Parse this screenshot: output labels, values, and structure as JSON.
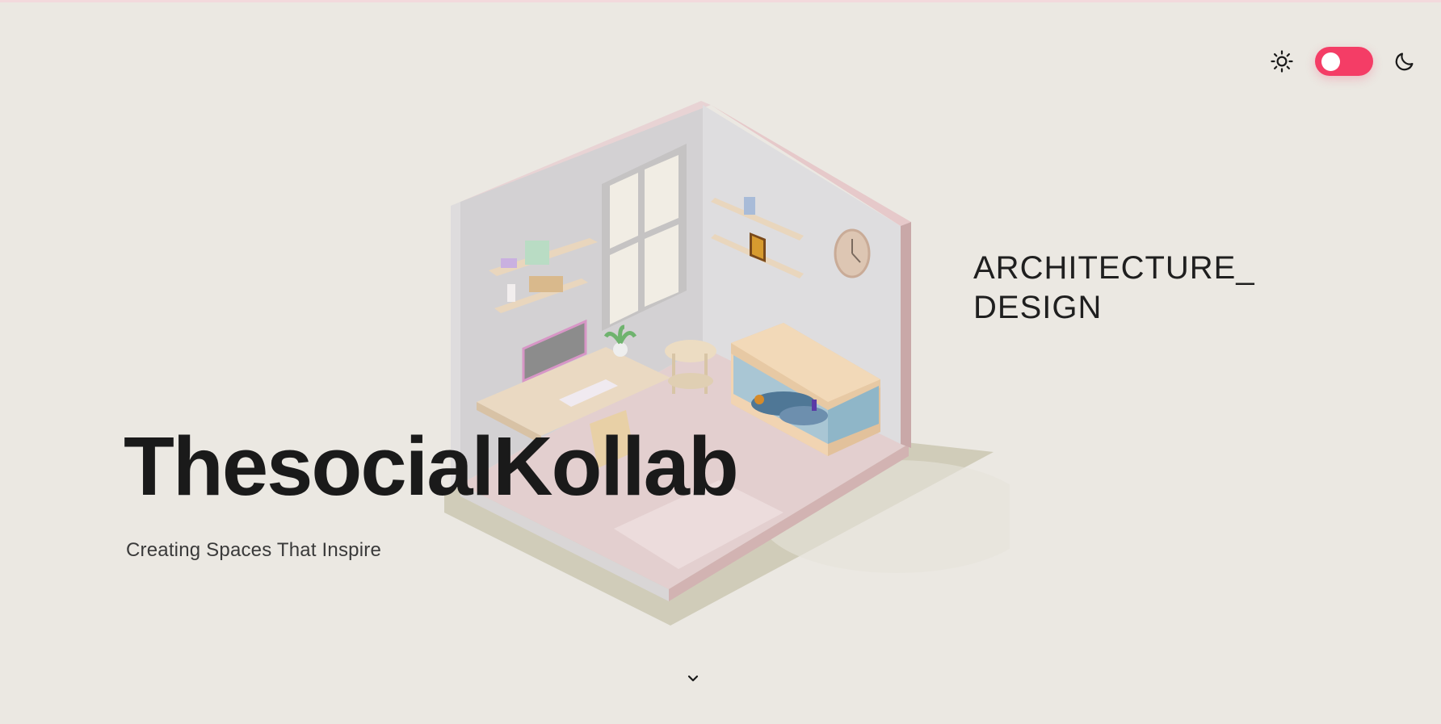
{
  "header": {
    "theme_toggle": {
      "light_icon": "sun-icon",
      "dark_icon": "moon-icon",
      "state": "light",
      "accent_color": "#f43d66"
    }
  },
  "hero": {
    "category_line1": "ARCHITECTURE_",
    "category_line2": "DESIGN",
    "brand": "ThesocialKollab",
    "tagline": "Creating Spaces That Inspire",
    "scroll_icon": "chevron-down-icon"
  },
  "colors": {
    "background": "#ebe8e2",
    "text": "#1a1a1a",
    "accent": "#f43d66"
  }
}
